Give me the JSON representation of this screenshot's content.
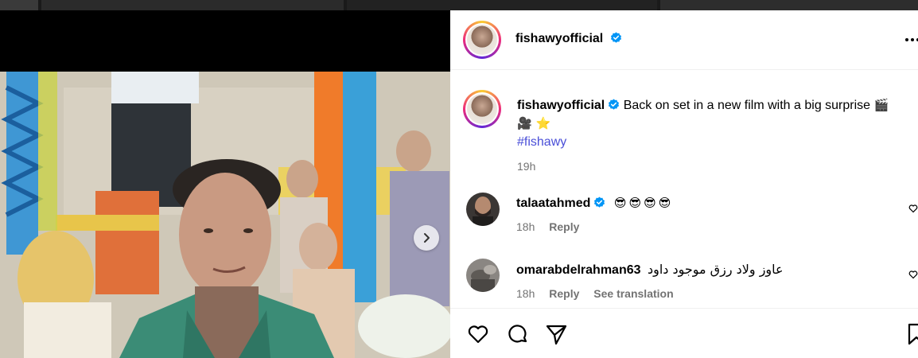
{
  "post": {
    "author": "fishawyofficial",
    "caption_line1": "Back on set in a new film with a big surprise",
    "caption_emoji1": "🎬",
    "caption_line2_emoji": "🎥 ⭐",
    "hashtag": "#fishawy",
    "time": "19h"
  },
  "comments": [
    {
      "user": "talaatahmed",
      "text": "😎😎😎😎",
      "time": "18h",
      "reply": "Reply"
    },
    {
      "user": "omarabdelrahman63",
      "text": "عاوز ولاد رزق موجود داود",
      "time": "18h",
      "reply": "Reply",
      "translate": "See translation"
    }
  ],
  "colors": {
    "verified": "#0095f6",
    "hashtag": "#4a4fd8",
    "muted": "#737373"
  },
  "icons": {
    "like": "heart-icon",
    "comment": "comment-icon",
    "share": "send-icon",
    "save": "bookmark-icon",
    "next": "chevron-right-icon",
    "more": "more-dots-icon"
  }
}
